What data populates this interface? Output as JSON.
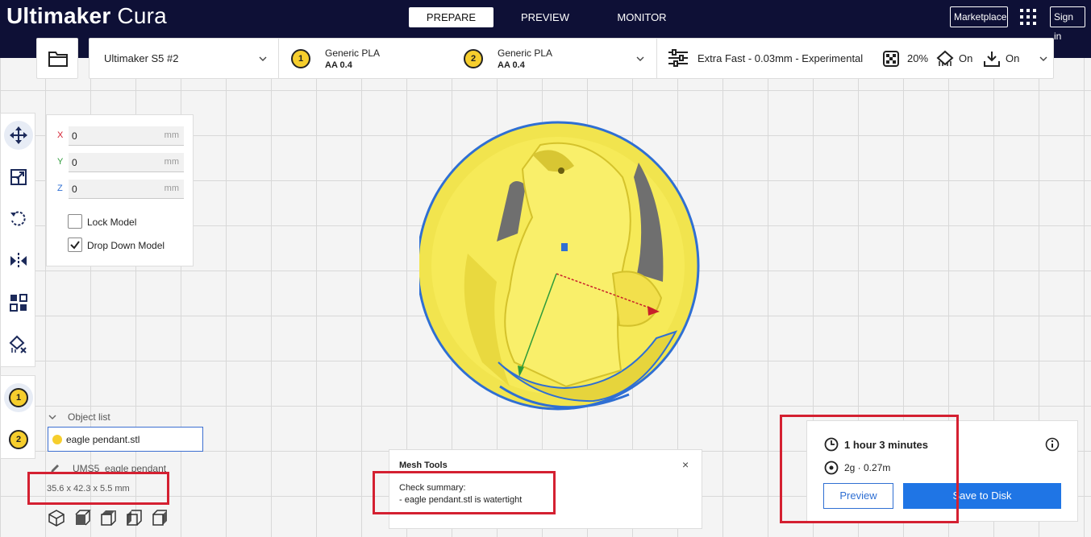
{
  "app": {
    "brand_bold": "Ultimaker",
    "brand_light": "Cura"
  },
  "stages": [
    "PREPARE",
    "PREVIEW",
    "MONITOR"
  ],
  "topbar": {
    "marketplace": "Marketplace",
    "sign_in": "Sign in"
  },
  "printer": {
    "name": "Ultimaker S5 #2"
  },
  "extruders": [
    {
      "number": "1",
      "material": "Generic PLA",
      "core": "AA 0.4"
    },
    {
      "number": "2",
      "material": "Generic PLA",
      "core": "AA 0.4"
    }
  ],
  "print_settings": {
    "profile": "Extra Fast - 0.03mm - Experimental",
    "infill": "20%",
    "support": "On",
    "adhesion": "On"
  },
  "move_tool": {
    "axes": [
      {
        "label": "X",
        "value": "0",
        "unit": "mm",
        "color": "#d42031"
      },
      {
        "label": "Y",
        "value": "0",
        "unit": "mm",
        "color": "#2e9b3a"
      },
      {
        "label": "Z",
        "value": "0",
        "unit": "mm",
        "color": "#2f6fd3"
      }
    ],
    "lock_model": "Lock Model",
    "drop_down_model": "Drop Down Model"
  },
  "object_list": {
    "header": "Object list",
    "item": "eagle pendant.stl",
    "job_name": "UMS5_eagle pendant",
    "dimensions": "35.6 x 42.3 x 5.5 mm"
  },
  "mesh_tools": {
    "title": "Mesh Tools",
    "close": "×",
    "line1": "Check summary:",
    "line2": "- eagle pendant.stl is watertight"
  },
  "print_job": {
    "time": "1 hour 3 minutes",
    "material": "2g · 0.27m",
    "preview_label": "Preview",
    "save_label": "Save to Disk"
  },
  "colors": {
    "accent": "#1f75e5",
    "header": "#0e1036",
    "model": "#f6ea58",
    "annotation": "#d42031"
  }
}
